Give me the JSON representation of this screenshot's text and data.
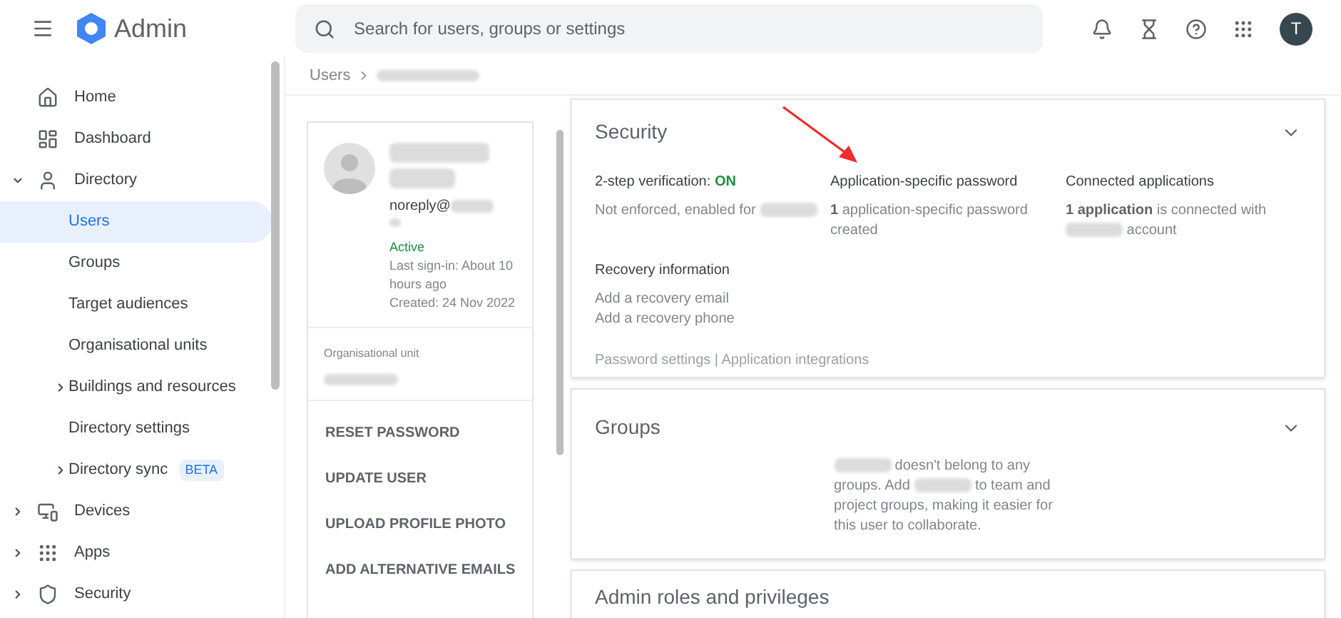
{
  "header": {
    "app_name": "Admin",
    "search_placeholder": "Search for users, groups or settings",
    "avatar_letter": "T"
  },
  "sidebar": {
    "items": [
      {
        "label": "Home",
        "kind": "link",
        "selected": false
      },
      {
        "label": "Dashboard",
        "kind": "link",
        "selected": false
      },
      {
        "label": "Directory",
        "kind": "group",
        "expanded": true,
        "selected": false,
        "children": [
          {
            "label": "Users",
            "kind": "link",
            "selected": true
          },
          {
            "label": "Groups",
            "kind": "link",
            "selected": false
          },
          {
            "label": "Target audiences",
            "kind": "link",
            "selected": false
          },
          {
            "label": "Organisational units",
            "kind": "link",
            "selected": false
          },
          {
            "label": "Buildings and resources",
            "kind": "group",
            "expanded": false,
            "selected": false
          },
          {
            "label": "Directory settings",
            "kind": "link",
            "selected": false
          },
          {
            "label": "Directory sync",
            "kind": "group",
            "expanded": false,
            "selected": false,
            "badge": "BETA"
          }
        ]
      },
      {
        "label": "Devices",
        "kind": "group",
        "expanded": false,
        "selected": false
      },
      {
        "label": "Apps",
        "kind": "group",
        "expanded": false,
        "selected": false
      },
      {
        "label": "Security",
        "kind": "group",
        "expanded": false,
        "selected": false
      }
    ]
  },
  "breadcrumb": [
    "Users"
  ],
  "user_card": {
    "email": "noreply@",
    "status": "Active",
    "last_signin": "Last sign-in: About 10 hours ago",
    "created": "Created: 24 Nov 2022",
    "org_unit_label": "Organisational unit",
    "actions": [
      "RESET PASSWORD",
      "UPDATE USER",
      "UPLOAD PROFILE PHOTO",
      "ADD ALTERNATIVE EMAILS"
    ]
  },
  "security": {
    "title": "Security",
    "expanded": true,
    "columns": [
      {
        "heading": "2-step verification: **ON**",
        "parts": [
          {
            "kind": "text",
            "text": "Not enforced, enabled for"
          },
          {
            "kind": "redacted"
          }
        ]
      },
      {
        "heading": "Application-specific password",
        "parts": [
          {
            "kind": "text",
            "text": "**1** application-specific password created"
          }
        ]
      },
      {
        "heading": "Connected applications",
        "parts": [
          {
            "kind": "text",
            "text": "**1 application** is connected with"
          },
          {
            "kind": "redacted"
          },
          {
            "kind": "text",
            "text": "account"
          }
        ]
      }
    ],
    "recovery": {
      "heading": "Recovery information",
      "lines": [
        "Add a recovery email",
        "Add a recovery phone"
      ]
    },
    "links": "Password settings | Application integrations"
  },
  "groups": {
    "title": "Groups",
    "expanded": true,
    "message_parts": [
      {
        "kind": "redacted"
      },
      {
        "kind": "text",
        "text": "doesn't belong to any groups. Add"
      },
      {
        "kind": "redacted"
      },
      {
        "kind": "text",
        "text": "to team and project groups, making it easier for this user to collaborate."
      }
    ]
  },
  "admin_roles": {
    "title": "Admin roles and privileges"
  }
}
